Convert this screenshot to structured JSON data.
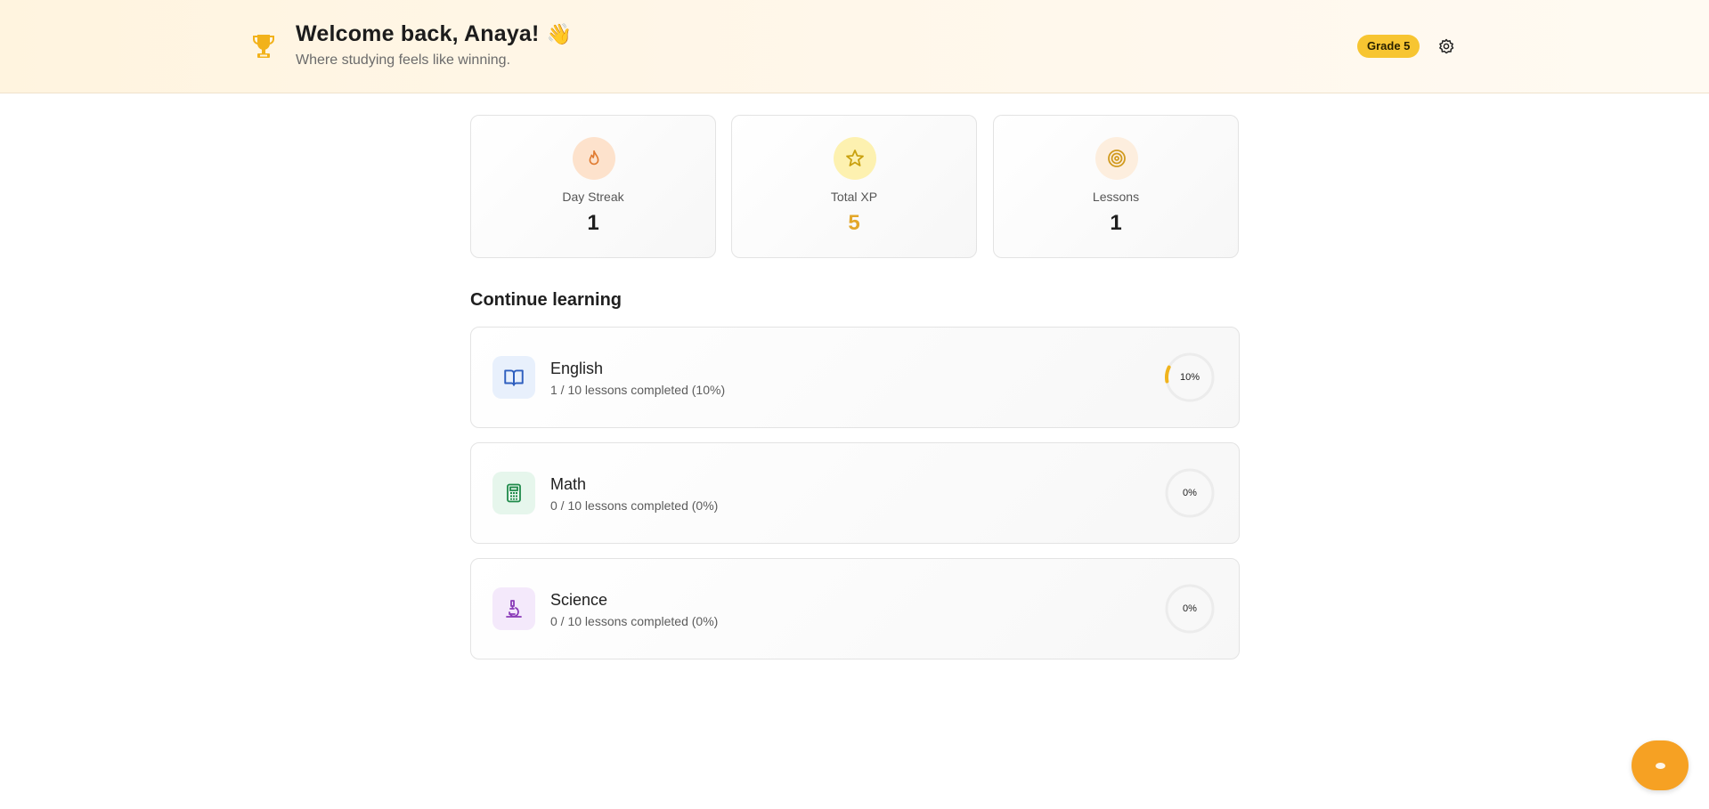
{
  "header": {
    "title": "Welcome back, Anaya!",
    "wave_emoji": "👋",
    "subtitle": "Where studying feels like winning.",
    "grade_badge": "Grade 5",
    "icons": {
      "trophy": "trophy-icon",
      "settings": "gear-icon"
    }
  },
  "stats": [
    {
      "label": "Day Streak",
      "value": "1",
      "icon": "flame-icon",
      "icon_bg": "#fde2cc",
      "icon_color": "#e07a2f"
    },
    {
      "label": "Total XP",
      "value": "5",
      "icon": "star-icon",
      "icon_bg": "#fdf1b0",
      "icon_color": "#c9a10f",
      "value_color": "#e3a72a"
    },
    {
      "label": "Lessons",
      "value": "1",
      "icon": "target-icon",
      "icon_bg": "#fdeede",
      "icon_color": "#d19a1e"
    }
  ],
  "section_title": "Continue learning",
  "subjects": [
    {
      "name": "English",
      "progress_text": "1 / 10 lessons completed (10%)",
      "percent_label": "10%",
      "progress": 0.1,
      "icon": "book-icon",
      "icon_bg": "#e8f0fc",
      "icon_color": "#2f5fbf"
    },
    {
      "name": "Math",
      "progress_text": "0 / 10 lessons completed (0%)",
      "percent_label": "0%",
      "progress": 0.0,
      "icon": "calculator-icon",
      "icon_bg": "#e6f6ec",
      "icon_color": "#1f8a4a"
    },
    {
      "name": "Science",
      "progress_text": "0 / 10 lessons completed (0%)",
      "percent_label": "0%",
      "progress": 0.0,
      "icon": "microscope-icon",
      "icon_bg": "#f4e9fb",
      "icon_color": "#8a3bb8"
    }
  ],
  "colors": {
    "accent": "#f6a123",
    "badge": "#f7c531",
    "ring_progress": "#f0b41d",
    "ring_track": "#ececec"
  },
  "fab": {
    "icon": "chat-icon"
  }
}
